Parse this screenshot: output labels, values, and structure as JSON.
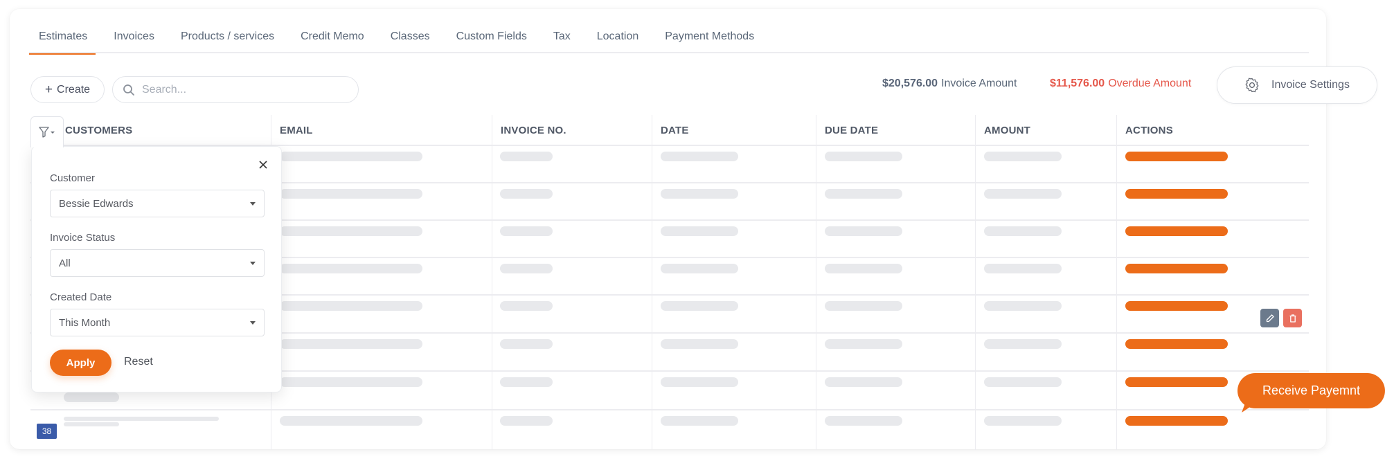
{
  "tabs": [
    {
      "label": "Estimates",
      "active": true
    },
    {
      "label": "Invoices",
      "active": false
    },
    {
      "label": "Products / services",
      "active": false
    },
    {
      "label": "Credit Memo",
      "active": false
    },
    {
      "label": "Classes",
      "active": false
    },
    {
      "label": "Custom Fields",
      "active": false
    },
    {
      "label": "Tax",
      "active": false
    },
    {
      "label": "Location",
      "active": false
    },
    {
      "label": "Payment Methods",
      "active": false
    }
  ],
  "toolbar": {
    "create_label": "Create",
    "search_placeholder": "Search...",
    "invoice_amount": "$20,576.00",
    "invoice_amount_label": "Invoice Amount",
    "overdue_amount": "$11,576.00",
    "overdue_amount_label": "Overdue Amount",
    "settings_label": "Invoice Settings"
  },
  "table": {
    "columns": [
      "CUSTOMERS",
      "EMAIL",
      "INVOICE NO.",
      "DATE",
      "DUE DATE",
      "AMOUNT",
      "ACTIONS"
    ],
    "row_count": 8,
    "rows_loading": true,
    "page_badge": "38",
    "hovered_row": 5
  },
  "filter": {
    "customer_label": "Customer",
    "customer_value": "Bessie Edwards",
    "status_label": "Invoice Status",
    "status_value": "All",
    "date_label": "Created Date",
    "date_value": "This Month",
    "apply_label": "Apply",
    "reset_label": "Reset"
  },
  "callout": {
    "receive_payment_label": "Receive Payemnt"
  },
  "colors": {
    "accent": "#ec6c19",
    "overdue": "#e5574a",
    "badge": "#3a5ba9",
    "edit": "#6b7a8c",
    "delete": "#e9705f"
  }
}
